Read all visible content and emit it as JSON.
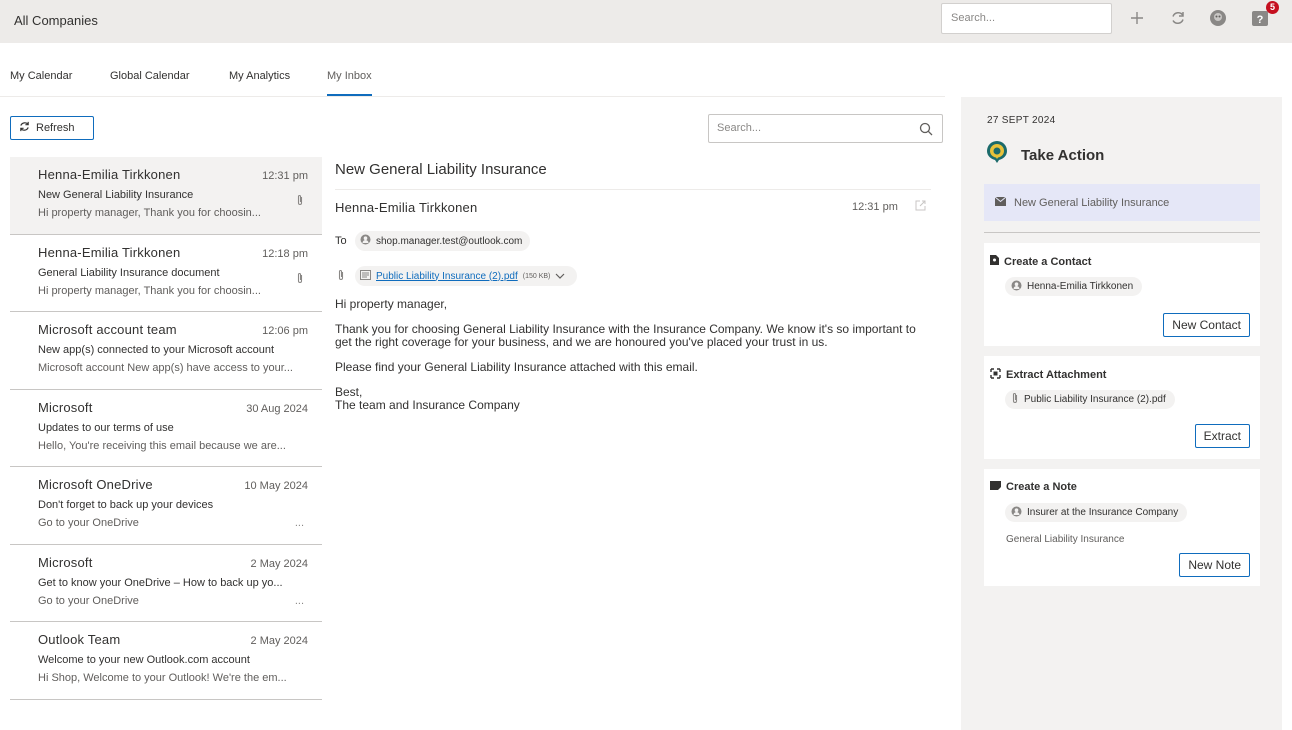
{
  "header": {
    "title": "All Companies",
    "search_placeholder": "Search...",
    "notification_count": "5"
  },
  "tabs": [
    {
      "label": "My Calendar"
    },
    {
      "label": "Global Calendar"
    },
    {
      "label": "My Analytics"
    },
    {
      "label": "My Inbox",
      "active": true
    }
  ],
  "inbox": {
    "refresh_label": "Refresh",
    "search_placeholder": "Search...",
    "emails": [
      {
        "sender": "Henna-Emilia Tirkkonen",
        "time": "12:31 pm",
        "subject": "New General Liability Insurance",
        "preview": "Hi property manager,  Thank you for choosin...",
        "attachment": true,
        "selected": true
      },
      {
        "sender": "Henna-Emilia Tirkkonen",
        "time": "12:18 pm",
        "subject": "General Liability Insurance document",
        "preview": "Hi property manager,  Thank you for choosin...",
        "attachment": true
      },
      {
        "sender": "Microsoft account team",
        "time": "12:06 pm",
        "subject": "New app(s) connected to your Microsoft account",
        "preview": "Microsoft account New app(s) have access to your..."
      },
      {
        "sender": "Microsoft",
        "time": "30 Aug 2024",
        "subject": "Updates to our terms of use",
        "preview": "Hello, You're receiving this email because we are..."
      },
      {
        "sender": "Microsoft OneDrive",
        "time": "10 May 2024",
        "subject": "Don't forget to back up your devices",
        "preview": "Go to your OneDrive",
        "ellipsis": "..."
      },
      {
        "sender": "Microsoft",
        "time": "2 May 2024",
        "subject": "Get to know your OneDrive – How to back up yo...",
        "preview": "Go to your OneDrive",
        "ellipsis": "..."
      },
      {
        "sender": "Outlook Team",
        "time": "2 May 2024",
        "subject": "Welcome to your new Outlook.com account",
        "preview": "Hi Shop, Welcome to your Outlook! We're the em..."
      }
    ]
  },
  "reading": {
    "subject": "New General Liability Insurance",
    "from": "Henna-Emilia Tirkkonen",
    "time": "12:31 pm",
    "to_label": "To",
    "to_address": "shop.manager.test@outlook.com",
    "attachment_name": "Public Liability Insurance (2).pdf",
    "attachment_size": "(150 KB)",
    "body": [
      "Hi property manager,",
      "Thank you for choosing General Liability Insurance with the Insurance Company. We know it's so important to get the right coverage for your business, and we are honoured you've placed your trust in us.",
      "Please find your General Liability Insurance attached with this email.",
      "Best,",
      "The team and Insurance Company"
    ]
  },
  "action_panel": {
    "date": "27 SEPT 2024",
    "title": "Take Action",
    "email_subject": "New General Liability Insurance",
    "contact": {
      "title": "Create a Contact",
      "chip": "Henna-Emilia Tirkkonen",
      "button": "New Contact"
    },
    "attachment": {
      "title": "Extract Attachment",
      "chip": "Public Liability Insurance (2).pdf",
      "button": "Extract"
    },
    "note": {
      "title": "Create a Note",
      "chip": "Insurer at the Insurance Company",
      "text": "General Liability Insurance",
      "button": "New Note"
    }
  },
  "colors": {
    "accent": "#0f6cbd",
    "badge": "#c50f1f",
    "highlight": "#e5e7f7"
  }
}
